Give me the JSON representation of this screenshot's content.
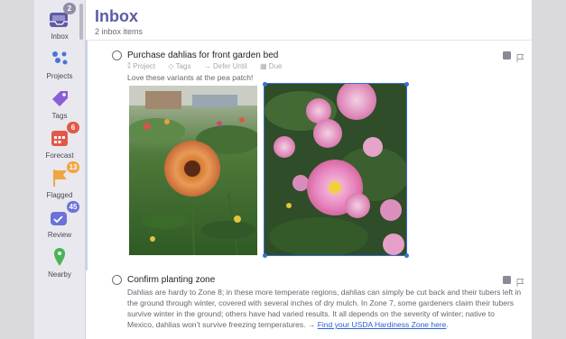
{
  "sidebar": {
    "items": [
      {
        "label": "Inbox",
        "badge": "2",
        "icon": "inbox-icon",
        "color": "#5e5aa5"
      },
      {
        "label": "Projects",
        "badge": "",
        "icon": "projects-icon",
        "color": "#4b74d6"
      },
      {
        "label": "Tags",
        "badge": "",
        "icon": "tag-icon",
        "color": "#8a5fd6"
      },
      {
        "label": "Forecast",
        "badge": "6",
        "icon": "calendar-icon",
        "color": "#e05a47"
      },
      {
        "label": "Flagged",
        "badge": "13",
        "icon": "flag-icon",
        "color": "#f0a540"
      },
      {
        "label": "Review",
        "badge": "45",
        "icon": "review-icon",
        "color": "#6b72d8"
      },
      {
        "label": "Nearby",
        "badge": "",
        "icon": "location-pin-icon",
        "color": "#4bb358"
      }
    ]
  },
  "header": {
    "title": "Inbox",
    "subtitle": "2 inbox items"
  },
  "tasks": [
    {
      "title": "Purchase dahlias for front garden bed",
      "meta": {
        "project": "Project",
        "tags": "Tags",
        "defer": "Defer Until",
        "due": "Due"
      },
      "note": "Love these variants at the pea patch!"
    },
    {
      "title": "Confirm planting zone",
      "note_text": "Dahlias are hardy to Zone 8; in these more temperate regions, dahlias can simply be cut back and their tubers left in the ground through winter, covered with several inches of dry mulch. In Zone 7, some gardeners claim their tubers survive winter in the ground; others have had varied results. It all depends on the severity of winter; native to Mexico, dahlias won’t survive freezing temperatures. →",
      "link_text": "Find your USDA Hardiness Zone here",
      "note_end": "."
    }
  ],
  "colors": {
    "accent": "#5e5aa5",
    "link": "#2c62cf",
    "selection": "#3a6fd8"
  }
}
